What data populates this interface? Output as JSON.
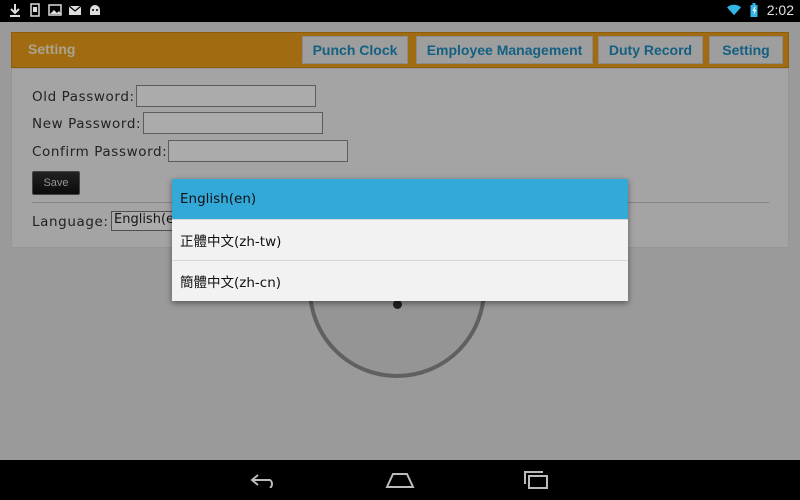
{
  "status_bar": {
    "time": "2:02",
    "left_icons": [
      "download-icon",
      "sd-card-icon",
      "image-icon",
      "mail-icon",
      "android-icon"
    ],
    "right_icons": [
      "wifi-icon",
      "battery-icon"
    ]
  },
  "header": {
    "title": "Setting",
    "tabs": [
      {
        "label": "Punch Clock"
      },
      {
        "label": "Employee Management"
      },
      {
        "label": "Duty Record"
      },
      {
        "label": "Setting"
      }
    ]
  },
  "form": {
    "old_password_label": "Old Password:",
    "old_password_value": "",
    "new_password_label": "New Password:",
    "new_password_value": "",
    "confirm_password_label": "Confirm Password:",
    "confirm_password_value": "",
    "save_label": "Save",
    "language_label": "Language:",
    "language_value": "English(en)"
  },
  "language_popup": {
    "options": [
      {
        "label": "English(en)",
        "selected": true
      },
      {
        "label": "正體中文(zh-tw)",
        "selected": false
      },
      {
        "label": "簡體中文(zh-cn)",
        "selected": false
      }
    ]
  },
  "nav_bar": {
    "icons": [
      "back-icon",
      "home-icon",
      "recent-apps-icon"
    ]
  },
  "colors": {
    "header_orange": "#f0a21a",
    "tab_text_blue": "#1f8fc0",
    "selected_option_blue": "#33a9d9"
  }
}
